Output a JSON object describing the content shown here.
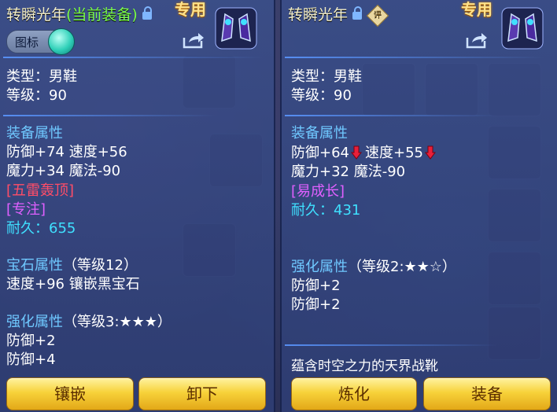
{
  "left": {
    "title": "转瞬光年",
    "title_status": "(当前装备)",
    "exclusive": "专用",
    "toggle_label": "图标",
    "type_line": "类型：男鞋",
    "level_line": "等级：90",
    "equip_attr_header": "装备属性",
    "attr_line1": "防御+74 速度+56",
    "attr_line2": "魔力+34 魔法-90",
    "special1": "[五雷轰顶]",
    "special2": "[专注]",
    "durability": "耐久：655",
    "gem_header": "宝石属性",
    "gem_level": "（等级12）",
    "gem_line": "速度+96 镶嵌黑宝石",
    "enhance_header": "强化属性",
    "enhance_level": "（等级3:★★★）",
    "enhance_line1": "防御+2",
    "enhance_line2": "防御+4",
    "btn_inlay": "镶嵌",
    "btn_unequip": "卸下"
  },
  "right": {
    "title": "转瞬光年",
    "ping_badge": "评",
    "exclusive": "专用",
    "type_line": "类型：男鞋",
    "level_line": "等级：90",
    "equip_attr_header": "装备属性",
    "def": "防御+64",
    "spd": "速度+55",
    "attr_line2": "魔力+32 魔法-90",
    "special1": "[易成长]",
    "durability": "耐久：431",
    "enhance_header": "强化属性",
    "enhance_level": "（等级2:★★☆）",
    "enhance_line1": "防御+2",
    "enhance_line2": "防御+2",
    "description": "蕴含时空之力的天界战靴",
    "btn_refine": "炼化",
    "btn_equip": "装备"
  },
  "colors": {
    "section": "#6fc8ff",
    "special_red": "#ff4d68",
    "special_magenta": "#e060ff",
    "durability": "#3fe0ff",
    "button": "#f7d23a",
    "down_arrow": "#e8203a"
  },
  "icons": [
    "lock-icon",
    "share-icon",
    "boots-item-icon",
    "down-arrow-icon",
    "rating-badge-icon"
  ]
}
